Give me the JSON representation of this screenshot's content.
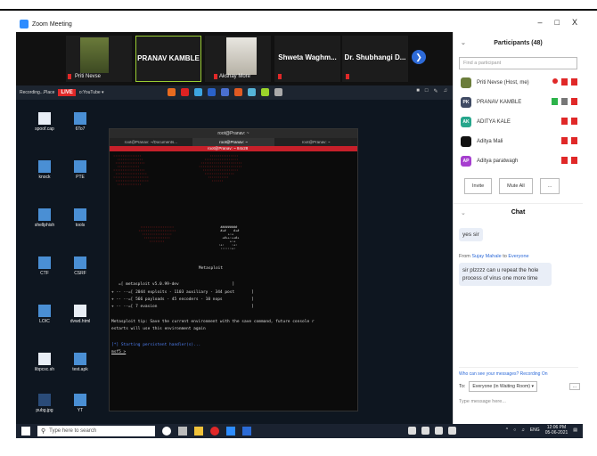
{
  "window": {
    "title": "Zoom Meeting",
    "controls": [
      "–",
      "□",
      "X"
    ]
  },
  "strip": {
    "tiles": [
      {
        "name": "Priti Nevse",
        "kind": "video"
      },
      {
        "name": "PRANAV KAMBLE",
        "kind": "name"
      },
      {
        "name": "Akshay More",
        "kind": "video"
      },
      {
        "name": "Shweta Waghm...",
        "kind": "name"
      },
      {
        "name": "Dr. Shubhangi D...",
        "kind": "name"
      }
    ],
    "next_icon": "chevron-right-icon"
  },
  "sharebar": {
    "live": "LIVE",
    "recording": "Recording...Place",
    "youtube": "o:YouTube ▾"
  },
  "desktop_icons": [
    {
      "label": "spoof.cap",
      "type": "doc"
    },
    {
      "label": "6To7",
      "type": "folder"
    },
    {
      "label": "knock",
      "type": "folder"
    },
    {
      "label": "PTE",
      "type": "folder"
    },
    {
      "label": "shellphish",
      "type": "folder"
    },
    {
      "label": "tools",
      "type": "folder"
    },
    {
      "label": "CTF",
      "type": "folder"
    },
    {
      "label": "CSRF",
      "type": "folder"
    },
    {
      "label": "LOIC",
      "type": "folder"
    },
    {
      "label": "dvwd.html",
      "type": "doc"
    },
    {
      "label": "libpcsc.sh",
      "type": "doc"
    },
    {
      "label": "test.apk",
      "type": "folder"
    },
    {
      "label": "pubg.jpg",
      "type": "dark"
    },
    {
      "label": "YT",
      "type": "folder"
    }
  ],
  "terminal": {
    "title": "root@Pranav: ~",
    "tabs": [
      "root@Pranav: ~/Documents...",
      "root@Pranav: ~",
      "root@Pranav: ~"
    ],
    "red_title": "root@Pranav: ~ 84x28",
    "banner": "Metasploit",
    "version": "=[ metasploit v5.0.99-dev                      ]",
    "lines": [
      "+ -- --=[ 2044 exploits - 1103 auxiliary - 344 post       ]",
      "+ -- --=[ 566 payloads - 45 encoders - 10 nops            ]",
      "+ -- --=[ 7 evasion                                       ]"
    ],
    "tip1": "Metasploit tip: Save the current environment with the save command, future console r",
    "tip2": "estarts will use this environment again",
    "handler": "[*] Starting persistent handler(s)...",
    "prompt": "msf5 >"
  },
  "panel": {
    "participants_title": "Participants (48)",
    "find_placeholder": "Find a participant",
    "participants": [
      {
        "name": "Priti Nevse (Host, me)",
        "initials": "",
        "color": "#6b7d3b"
      },
      {
        "name": "PRANAV KAMBLE",
        "initials": "PK",
        "color": "#3f4a63"
      },
      {
        "name": "ADITYA KALE",
        "initials": "AK",
        "color": "#26a68c"
      },
      {
        "name": "Aditya Mali",
        "initials": "",
        "color": "#111111"
      },
      {
        "name": "Aditya paratwagh",
        "initials": "AP",
        "color": "#a63fcf"
      }
    ],
    "invite": "Invite",
    "mute_all": "Mute All",
    "more": "...",
    "chat_title": "Chat",
    "msg1": "yes sir",
    "from_prefix": "From",
    "from_name": "Sujay Mahale",
    "to_word": "to",
    "to_name": "Everyone",
    "msg2": "sir plzzzz can u repeat the hole process of virus one more time",
    "who_can_see": "Who can see your messages? Recording On",
    "to_label": "To:",
    "to_select": "Everyone (in Waiting Room) ▾",
    "type_placeholder": "Type message here..."
  },
  "taskbar": {
    "search": "Type here to search",
    "lang": "ENG",
    "time": "12:06 PM",
    "date": "05-06-2021"
  }
}
